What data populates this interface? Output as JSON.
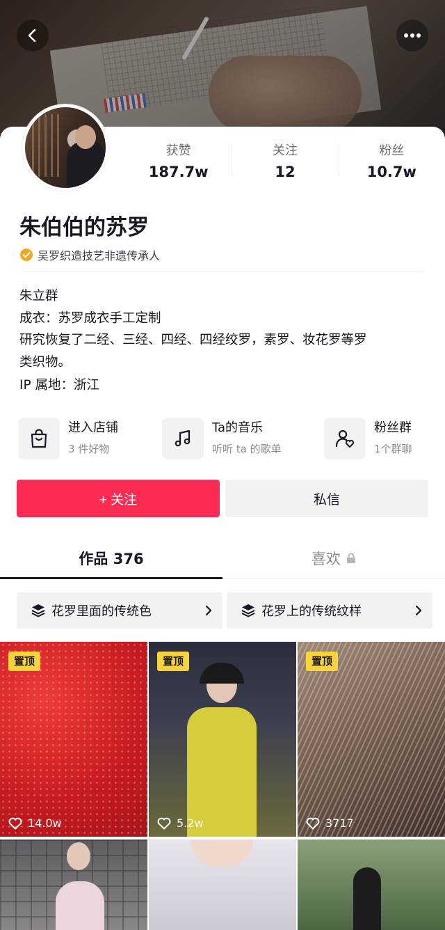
{
  "header": {
    "back_icon": "chevron-left-icon",
    "more_icon": "more-horizontal-icon"
  },
  "stats": [
    {
      "label": "获赞",
      "value": "187.7w"
    },
    {
      "label": "关注",
      "value": "12"
    },
    {
      "label": "粉丝",
      "value": "10.7w"
    }
  ],
  "profile": {
    "name": "朱伯伯的苏罗",
    "verification": "吴罗织造技艺非遗传承人",
    "verify_color": "#f5a623",
    "bio_lines": [
      "朱立群",
      "成衣：苏罗成衣手工定制",
      "研究恢复了二经、三经、四经、四经绞罗，素罗、妆花罗等罗",
      "类织物。"
    ],
    "ip_location": "IP 属地：浙江"
  },
  "shortcuts": [
    {
      "title": "进入店铺",
      "subtitle": "3 件好物",
      "icon": "shopping-bag-icon"
    },
    {
      "title": "Ta的音乐",
      "subtitle": "听听 ta 的歌单",
      "icon": "music-note-icon"
    },
    {
      "title": "粉丝群",
      "subtitle": "1个群聊",
      "icon": "group-heart-icon"
    }
  ],
  "actions": {
    "follow_label": "+ 关注",
    "message_label": "私信",
    "follow_color": "#fe2c55"
  },
  "tabs": {
    "works": "作品 376",
    "likes": "喜欢"
  },
  "collections": [
    {
      "label": "花罗里面的传统色",
      "icon": "layers-icon"
    },
    {
      "label": "花罗上的传统纹样",
      "icon": "layers-icon"
    }
  ],
  "videos": [
    {
      "pinned": "置顶",
      "likes": "14.0w"
    },
    {
      "pinned": "置顶",
      "likes": "5.2w"
    },
    {
      "pinned": "置顶",
      "likes": "3717"
    },
    {
      "pinned": "",
      "likes": ""
    },
    {
      "pinned": "",
      "likes": ""
    },
    {
      "pinned": "",
      "likes": ""
    }
  ]
}
